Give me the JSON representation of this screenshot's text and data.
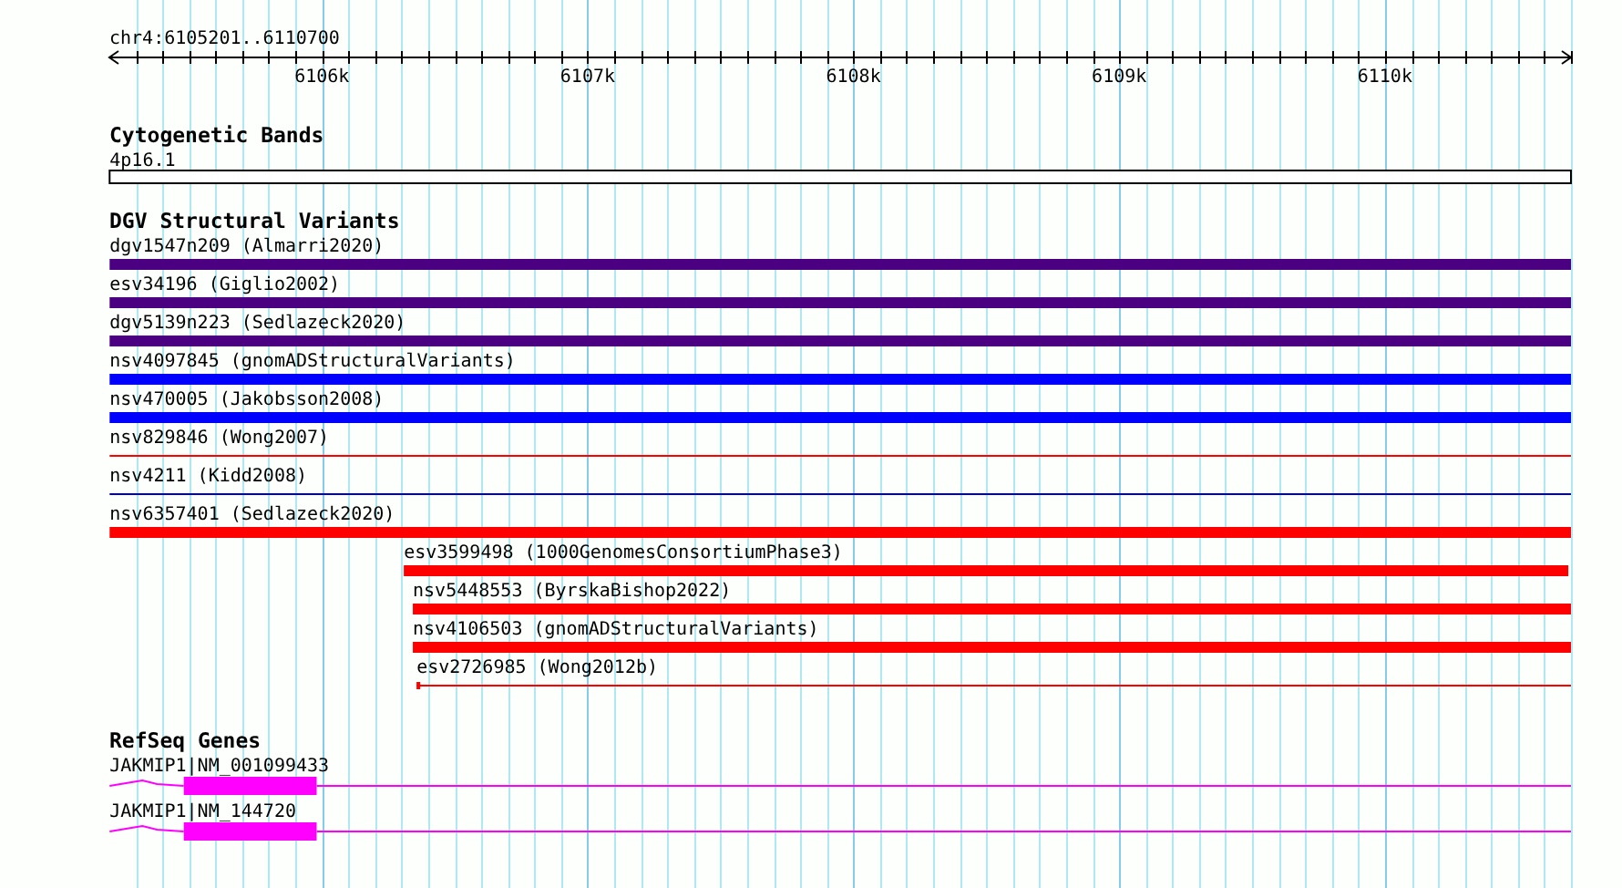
{
  "location": "chr4:6105201..6110700",
  "ruler": {
    "ticks": [
      "6106k",
      "6107k",
      "6108k",
      "6109k",
      "6110k"
    ]
  },
  "tracks": [
    {
      "kind": "bands",
      "title": "Cytogenetic Bands",
      "features": [
        {
          "label": "4p16.1"
        }
      ]
    },
    {
      "kind": "variants",
      "title": "DGV Structural Variants",
      "features": [
        {
          "label": "dgv1547n209 (Almarri2020)",
          "kind": "thick",
          "color": "#4b0082"
        },
        {
          "label": "esv34196 (Giglio2002)",
          "kind": "thick",
          "color": "#4b0082"
        },
        {
          "label": "dgv5139n223 (Sedlazeck2020)",
          "kind": "thick",
          "color": "#4b0082"
        },
        {
          "label": "nsv4097845 (gnomADStructuralVariants)",
          "kind": "thick",
          "color": "#0000ff"
        },
        {
          "label": "nsv470005 (Jakobsson2008)",
          "kind": "thick",
          "color": "#0000ff"
        },
        {
          "label": "nsv829846 (Wong2007)",
          "kind": "thin",
          "color": "#ff0000"
        },
        {
          "label": "nsv4211 (Kidd2008)",
          "kind": "thin",
          "color": "#0000cc"
        },
        {
          "label": "nsv6357401 (Sedlazeck2020)",
          "kind": "thick",
          "color": "#ff0000"
        },
        {
          "label": "esv3599498 (1000GenomesConsortiumPhase3)",
          "kind": "thick",
          "color": "#ff0000"
        },
        {
          "label": "nsv5448553 (ByrskaBishop2022)",
          "kind": "thick",
          "color": "#ff0000"
        },
        {
          "label": "nsv4106503 (gnomADStructuralVariants)",
          "kind": "thick",
          "color": "#ff0000"
        },
        {
          "label": "esv2726985 (Wong2012b)",
          "kind": "thin",
          "color": "#ff0000"
        }
      ]
    },
    {
      "kind": "genes",
      "title": "RefSeq Genes",
      "features": [
        {
          "label": "JAKMIP1|NM_001099433"
        },
        {
          "label": "JAKMIP1|NM_144720"
        }
      ]
    }
  ]
}
